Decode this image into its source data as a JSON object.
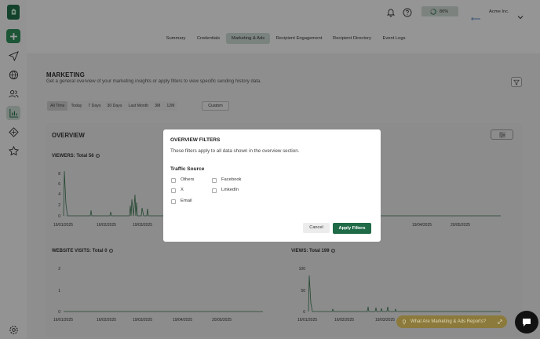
{
  "topbar": {
    "progress_label": "80%",
    "account_name": "Acme Inc."
  },
  "tabs": [
    "Summary",
    "Credentials",
    "Marketing & Ads",
    "Recipient Engagement",
    "Recipient Directory",
    "Event Logs"
  ],
  "active_tab": "Marketing & Ads",
  "page": {
    "title": "MARKETING",
    "description": "Get a general overview of your marketing insights or apply filters to view specific sending history data."
  },
  "ranges": [
    "All Time",
    "Today",
    "7 Days",
    "30 Days",
    "Last Month",
    "3M",
    "12M"
  ],
  "custom_label": "Custom",
  "overview": {
    "title": "OVERVIEW"
  },
  "charts": {
    "viewers": {
      "title": "VIEWERS: Total 56",
      "yticks": [
        "8",
        "6",
        "4",
        "2",
        "0"
      ],
      "xticks": [
        "16/01/2025",
        "16/02/2025",
        "19/03/2025",
        "19/04/2025",
        "20/05/2025"
      ]
    },
    "website_visits": {
      "title": "WEBSITE VISITS: Total 0",
      "yticks": [
        "2",
        "1",
        "0"
      ],
      "xticks": [
        "16/01/2025",
        "16/02/2025",
        "19/03/2025",
        "19/04/2025",
        "20/05/2025"
      ]
    },
    "views": {
      "title": "VIEWS: Total 199",
      "yticks": [
        "100",
        "50",
        "0"
      ],
      "xticks": [
        "16/01/2025",
        "16/02/2025",
        "19/03/2025"
      ]
    }
  },
  "modal": {
    "title": "OVERVIEW FILTERS",
    "description": "These filters apply to all data shown in the overview section.",
    "section_title": "Traffic Source",
    "options": [
      "Others",
      "X",
      "Email",
      "Facebook",
      "LinkedIn"
    ],
    "cancel_label": "Cancel",
    "apply_label": "Apply Filters"
  },
  "help": {
    "label": "What Are Marketing & Ads Reports?"
  },
  "colors": {
    "brand": "#1f6b48",
    "accent_green": "#3c8a5f",
    "chart_line": "#3a7350",
    "help_pill": "#8b7a3b"
  }
}
